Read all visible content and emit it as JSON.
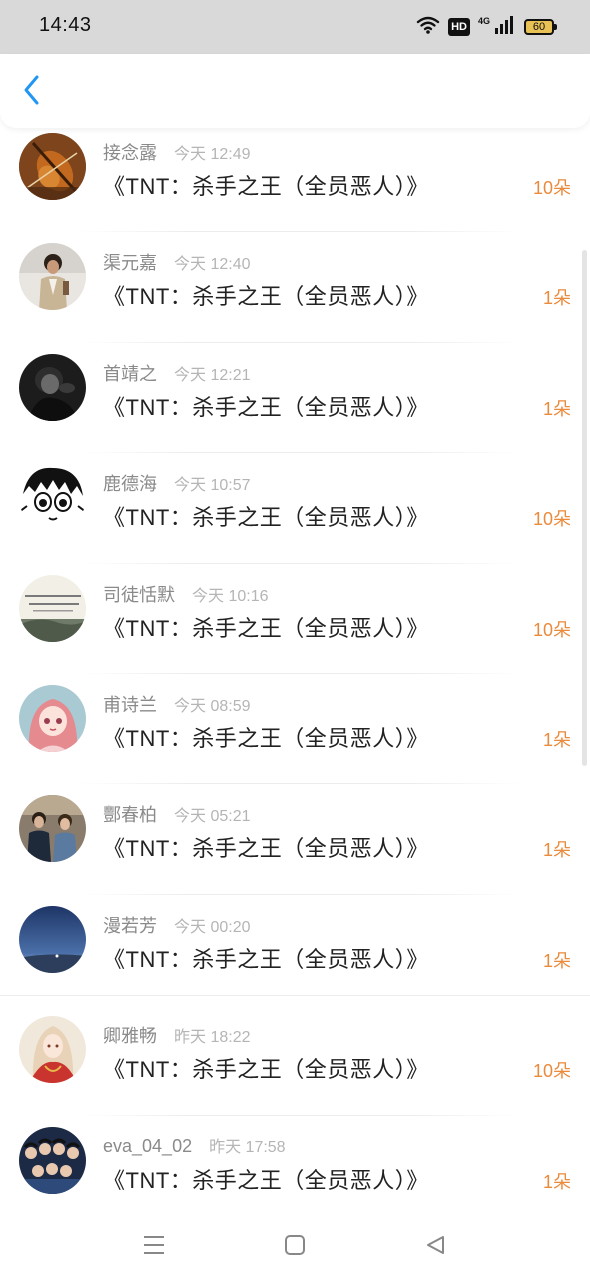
{
  "status_bar": {
    "time": "14:43",
    "hd_label": "HD",
    "network_label": "4G",
    "battery": "60",
    "battery_color": "#e8c254"
  },
  "header": {
    "back_icon": "chevron-left-icon",
    "accent_color": "#2196f3"
  },
  "list": {
    "count_color": "#ea8a3b",
    "items": [
      {
        "name": "接念露",
        "time": "今天 12:49",
        "title": "《TNT：杀手之王（全员恶人）》",
        "count": "10朵",
        "avatar": "violin"
      },
      {
        "name": "渠元嘉",
        "time": "今天 12:40",
        "title": "《TNT：杀手之王（全员恶人）》",
        "count": "1朵",
        "avatar": "person-street"
      },
      {
        "name": "首靖之",
        "time": "今天 12:21",
        "title": "《TNT：杀手之王（全员恶人）》",
        "count": "1朵",
        "avatar": "dark-portrait"
      },
      {
        "name": "鹿德海",
        "time": "今天 10:57",
        "title": "《TNT：杀手之王（全员恶人）》",
        "count": "10朵",
        "avatar": "anime-lineart"
      },
      {
        "name": "司徒恬默",
        "time": "今天 10:16",
        "title": "《TNT：杀手之王（全员恶人）》",
        "count": "10朵",
        "avatar": "text-landscape"
      },
      {
        "name": "甫诗兰",
        "time": "今天 08:59",
        "title": "《TNT：杀手之王（全员恶人）》",
        "count": "1朵",
        "avatar": "anime-pink-girl"
      },
      {
        "name": "酆春柏",
        "time": "今天 05:21",
        "title": "《TNT：杀手之王（全员恶人）》",
        "count": "1朵",
        "avatar": "two-people"
      },
      {
        "name": "漫若芳",
        "time": "今天 00:20",
        "title": "《TNT：杀手之王（全员恶人）》",
        "count": "1朵",
        "avatar": "blue-sky"
      },
      {
        "name": "卿雅畅",
        "time": "昨天 18:22",
        "title": "《TNT：杀手之王（全员恶人）》",
        "count": "10朵",
        "avatar": "anime-costume"
      },
      {
        "name": "eva_04_02",
        "time": "昨天 17:58",
        "title": "《TNT：杀手之王（全员恶人）》",
        "count": "1朵",
        "avatar": "group-photo"
      }
    ]
  },
  "nav_bar": {
    "menu_icon": "menu-icon",
    "home_icon": "home-square-icon",
    "back_icon": "back-triangle-icon"
  }
}
